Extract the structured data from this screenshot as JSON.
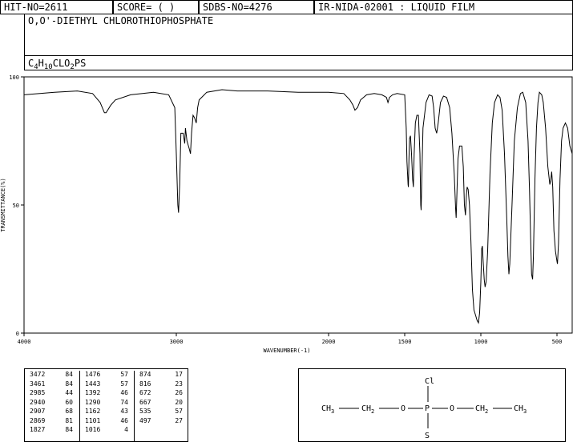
{
  "header": {
    "hit_no": "HIT-NO=2611",
    "score": "SCORE=  (  )",
    "sdbs_no": "SDBS-NO=4276",
    "method": "IR-NIDA-02001 : LIQUID FILM"
  },
  "compound": {
    "name": "O,O'-DIETHYL CHLOROTHIOPHOSPHATE",
    "formula_parts": [
      {
        "t": "C",
        "sub": false
      },
      {
        "t": "4",
        "sub": true
      },
      {
        "t": "H",
        "sub": false
      },
      {
        "t": "10",
        "sub": true
      },
      {
        "t": "CLO",
        "sub": false
      },
      {
        "t": "2",
        "sub": true
      },
      {
        "t": "PS",
        "sub": false
      }
    ]
  },
  "chart_data": {
    "type": "line",
    "xlabel": "WAVENUMBER(-1)",
    "ylabel": "TRANSMITTANCE(%)",
    "xlim": [
      4000,
      400
    ],
    "ylim": [
      0,
      100
    ],
    "x_ticks": [
      4000,
      3000,
      2000,
      1500,
      1000,
      500
    ],
    "y_ticks": [
      0,
      50,
      100
    ],
    "series": [
      {
        "points": [
          [
            4000,
            93
          ],
          [
            3800,
            94
          ],
          [
            3650,
            94.5
          ],
          [
            3550,
            93.5
          ],
          [
            3500,
            90
          ],
          [
            3472,
            86
          ],
          [
            3461,
            86
          ],
          [
            3430,
            89
          ],
          [
            3400,
            91
          ],
          [
            3300,
            93
          ],
          [
            3150,
            94
          ],
          [
            3050,
            93
          ],
          [
            3010,
            88
          ],
          [
            3000,
            70
          ],
          [
            2990,
            50
          ],
          [
            2985,
            47
          ],
          [
            2978,
            58
          ],
          [
            2970,
            78
          ],
          [
            2955,
            78
          ],
          [
            2945,
            74
          ],
          [
            2940,
            80
          ],
          [
            2930,
            75
          ],
          [
            2915,
            72
          ],
          [
            2907,
            70
          ],
          [
            2900,
            78
          ],
          [
            2890,
            85
          ],
          [
            2880,
            84
          ],
          [
            2869,
            82
          ],
          [
            2860,
            88
          ],
          [
            2850,
            91
          ],
          [
            2800,
            94
          ],
          [
            2700,
            95
          ],
          [
            2600,
            94.5
          ],
          [
            2400,
            94.5
          ],
          [
            2200,
            94
          ],
          [
            2000,
            94
          ],
          [
            1900,
            93.5
          ],
          [
            1860,
            91
          ],
          [
            1840,
            89
          ],
          [
            1827,
            87
          ],
          [
            1810,
            88
          ],
          [
            1790,
            91
          ],
          [
            1750,
            93
          ],
          [
            1700,
            93.5
          ],
          [
            1650,
            93
          ],
          [
            1620,
            92
          ],
          [
            1610,
            90
          ],
          [
            1600,
            92
          ],
          [
            1580,
            93
          ],
          [
            1550,
            93.5
          ],
          [
            1500,
            93
          ],
          [
            1490,
            80
          ],
          [
            1485,
            67
          ],
          [
            1478,
            58
          ],
          [
            1476,
            57
          ],
          [
            1472,
            68
          ],
          [
            1468,
            76
          ],
          [
            1462,
            77
          ],
          [
            1455,
            70
          ],
          [
            1448,
            60
          ],
          [
            1443,
            57
          ],
          [
            1438,
            70
          ],
          [
            1430,
            82
          ],
          [
            1420,
            85
          ],
          [
            1410,
            85
          ],
          [
            1400,
            70
          ],
          [
            1395,
            50
          ],
          [
            1392,
            48
          ],
          [
            1388,
            60
          ],
          [
            1380,
            80
          ],
          [
            1360,
            90
          ],
          [
            1340,
            93
          ],
          [
            1320,
            92.5
          ],
          [
            1310,
            88
          ],
          [
            1300,
            80
          ],
          [
            1290,
            78
          ],
          [
            1280,
            82
          ],
          [
            1265,
            90
          ],
          [
            1245,
            92.5
          ],
          [
            1225,
            92
          ],
          [
            1205,
            88
          ],
          [
            1190,
            78
          ],
          [
            1175,
            62
          ],
          [
            1165,
            48
          ],
          [
            1162,
            45
          ],
          [
            1157,
            55
          ],
          [
            1150,
            68
          ],
          [
            1140,
            73
          ],
          [
            1125,
            73
          ],
          [
            1115,
            65
          ],
          [
            1108,
            50
          ],
          [
            1101,
            46
          ],
          [
            1095,
            54
          ],
          [
            1090,
            57
          ],
          [
            1083,
            56
          ],
          [
            1075,
            50
          ],
          [
            1065,
            36
          ],
          [
            1055,
            17
          ],
          [
            1045,
            9
          ],
          [
            1035,
            7
          ],
          [
            1025,
            5
          ],
          [
            1016,
            4
          ],
          [
            1008,
            8
          ],
          [
            1000,
            20
          ],
          [
            994,
            33
          ],
          [
            990,
            34
          ],
          [
            985,
            28
          ],
          [
            978,
            21
          ],
          [
            972,
            18
          ],
          [
            965,
            20
          ],
          [
            955,
            32
          ],
          [
            940,
            62
          ],
          [
            925,
            82
          ],
          [
            910,
            90
          ],
          [
            890,
            93
          ],
          [
            874,
            92
          ],
          [
            860,
            87
          ],
          [
            845,
            70
          ],
          [
            830,
            45
          ],
          [
            822,
            30
          ],
          [
            816,
            23
          ],
          [
            810,
            27
          ],
          [
            795,
            50
          ],
          [
            780,
            75
          ],
          [
            760,
            88
          ],
          [
            740,
            93.5
          ],
          [
            725,
            94
          ],
          [
            705,
            90
          ],
          [
            690,
            75
          ],
          [
            680,
            55
          ],
          [
            672,
            35
          ],
          [
            667,
            23
          ],
          [
            660,
            21
          ],
          [
            655,
            30
          ],
          [
            645,
            60
          ],
          [
            635,
            80
          ],
          [
            625,
            90
          ],
          [
            615,
            94
          ],
          [
            600,
            93
          ],
          [
            590,
            90
          ],
          [
            575,
            80
          ],
          [
            560,
            65
          ],
          [
            547,
            58
          ],
          [
            540,
            60
          ],
          [
            535,
            63
          ],
          [
            528,
            57
          ],
          [
            520,
            40
          ],
          [
            510,
            32
          ],
          [
            500,
            28
          ],
          [
            497,
            27
          ],
          [
            490,
            35
          ],
          [
            480,
            60
          ],
          [
            470,
            75
          ],
          [
            460,
            80
          ],
          [
            445,
            82
          ],
          [
            430,
            80
          ],
          [
            415,
            73
          ],
          [
            400,
            70
          ]
        ]
      }
    ]
  },
  "peaks": [
    [
      [
        "3472",
        "84"
      ],
      [
        "3461",
        "84"
      ],
      [
        "2985",
        "44"
      ],
      [
        "2940",
        "60"
      ],
      [
        "2907",
        "68"
      ],
      [
        "2869",
        "81"
      ],
      [
        "1827",
        "84"
      ]
    ],
    [
      [
        "1476",
        "57"
      ],
      [
        "1443",
        "57"
      ],
      [
        "1392",
        "46"
      ],
      [
        "1290",
        "74"
      ],
      [
        "1162",
        "43"
      ],
      [
        "1101",
        "46"
      ],
      [
        "1016",
        "4"
      ]
    ],
    [
      [
        "874",
        "17"
      ],
      [
        "816",
        "23"
      ],
      [
        "672",
        "26"
      ],
      [
        "667",
        "20"
      ],
      [
        "535",
        "57"
      ],
      [
        "497",
        "27"
      ]
    ]
  ],
  "structure": {
    "chain_left": "CH3—CH2—O—",
    "center": "P",
    "chain_right": "—O—CH2—CH3",
    "top_atom": "Cl",
    "bottom_atom": "S",
    "atoms": {
      "ch3_left": "CH",
      "ch3_left_sub": "3",
      "ch2_left": "CH",
      "ch2_left_sub": "2",
      "o_left": "O",
      "p": "P",
      "o_right": "O",
      "ch2_right": "CH",
      "ch2_right_sub": "2",
      "ch3_right": "CH",
      "ch3_right_sub": "3",
      "cl": "Cl",
      "s": "S"
    }
  }
}
